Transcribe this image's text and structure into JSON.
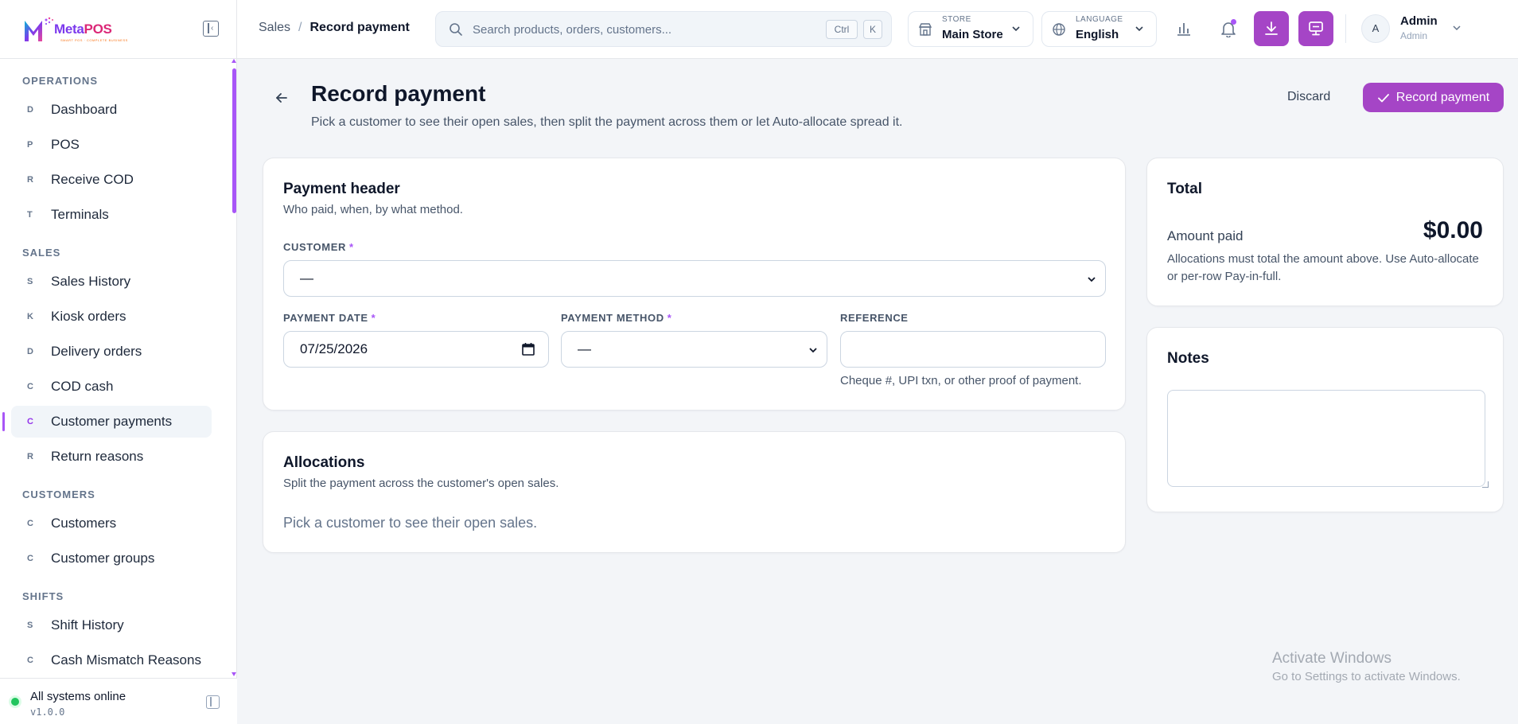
{
  "app": {
    "name_part1": "Meta",
    "name_part2": "POS",
    "tagline": "SMART POS · COMPLETE BUSINESS"
  },
  "sidebar": {
    "sections": [
      {
        "title": "OPERATIONS",
        "items": [
          {
            "letter": "D",
            "label": "Dashboard"
          },
          {
            "letter": "P",
            "label": "POS"
          },
          {
            "letter": "R",
            "label": "Receive COD"
          },
          {
            "letter": "T",
            "label": "Terminals"
          }
        ]
      },
      {
        "title": "SALES",
        "items": [
          {
            "letter": "S",
            "label": "Sales History"
          },
          {
            "letter": "K",
            "label": "Kiosk orders"
          },
          {
            "letter": "D",
            "label": "Delivery orders"
          },
          {
            "letter": "C",
            "label": "COD cash"
          },
          {
            "letter": "C",
            "label": "Customer payments",
            "active": true
          },
          {
            "letter": "R",
            "label": "Return reasons"
          }
        ]
      },
      {
        "title": "CUSTOMERS",
        "items": [
          {
            "letter": "C",
            "label": "Customers"
          },
          {
            "letter": "C",
            "label": "Customer groups"
          }
        ]
      },
      {
        "title": "SHIFTS",
        "items": [
          {
            "letter": "S",
            "label": "Shift History"
          },
          {
            "letter": "C",
            "label": "Cash Mismatch Reasons"
          }
        ]
      }
    ],
    "status": "All systems online",
    "version": "v1.0.0"
  },
  "topbar": {
    "breadcrumb": {
      "parent": "Sales",
      "separator": "/",
      "current": "Record payment"
    },
    "search": {
      "placeholder": "Search products, orders, customers...",
      "kbd1": "Ctrl",
      "kbd2": "K"
    },
    "store": {
      "caption": "STORE",
      "value": "Main Store"
    },
    "language": {
      "caption": "LANGUAGE",
      "value": "English"
    },
    "user": {
      "initial": "A",
      "name": "Admin",
      "role": "Admin"
    }
  },
  "page": {
    "title": "Record payment",
    "subtitle": "Pick a customer to see their open sales, then split the payment across them or let Auto-allocate spread it.",
    "discard_label": "Discard",
    "record_label": "Record payment"
  },
  "payment_header": {
    "title": "Payment header",
    "subtitle": "Who paid, when, by what method.",
    "customer_label": "CUSTOMER",
    "customer_value": "—",
    "date_label": "PAYMENT DATE",
    "date_value": "07/25/2026",
    "method_label": "PAYMENT METHOD",
    "method_value": "—",
    "reference_label": "REFERENCE",
    "reference_value": "",
    "reference_hint": "Cheque #, UPI txn, or other proof of payment.",
    "required_mark": "*"
  },
  "allocations": {
    "title": "Allocations",
    "subtitle": "Split the payment across the customer's open sales.",
    "empty": "Pick a customer to see their open sales."
  },
  "total": {
    "title": "Total",
    "amount_label": "Amount paid",
    "amount_value": "$0.00",
    "hint": "Allocations must total the amount above. Use Auto-allocate or per-row Pay-in-full."
  },
  "notes": {
    "title": "Notes",
    "value": ""
  },
  "watermark": {
    "line1": "Activate Windows",
    "line2": "Go to Settings to activate Windows."
  },
  "colors": {
    "accent": "#a545c6",
    "status": "#22c55e"
  }
}
